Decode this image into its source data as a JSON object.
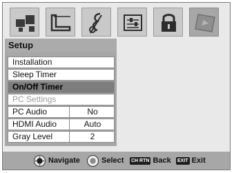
{
  "tabs": [
    {
      "icon": "picture-icon",
      "active": false
    },
    {
      "icon": "tv-screen-icon",
      "active": false
    },
    {
      "icon": "music-note-icon",
      "active": false
    },
    {
      "icon": "settings-sliders-icon",
      "active": false
    },
    {
      "icon": "lock-icon",
      "active": false
    },
    {
      "icon": "setup-card-icon",
      "active": true
    }
  ],
  "menu": {
    "title": "Setup",
    "items": [
      {
        "label": "Installation",
        "state": "normal"
      },
      {
        "label": "Sleep Timer",
        "state": "normal"
      },
      {
        "label": "On/Off Timer",
        "state": "selected"
      },
      {
        "label": "PC Settings",
        "state": "disabled"
      },
      {
        "label": "PC Audio",
        "value": "No",
        "state": "normal"
      },
      {
        "label": "HDMI Audio",
        "value": "Auto",
        "state": "normal"
      },
      {
        "label": "Gray Level",
        "value": "2",
        "state": "normal"
      }
    ]
  },
  "nav": {
    "navigate_label": "Navigate",
    "select_label": "Select",
    "back_key": "CH RTN",
    "back_label": "Back",
    "exit_key": "EXIT",
    "exit_label": "Exit"
  }
}
